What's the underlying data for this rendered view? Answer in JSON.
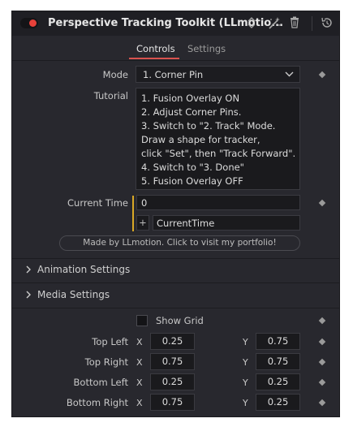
{
  "header": {
    "title": "Perspective Tracking Toolkit (LLmotio..."
  },
  "tabs": [
    {
      "label": "Controls"
    },
    {
      "label": "Settings"
    }
  ],
  "mode": {
    "label": "Mode",
    "value": "1. Corner Pin"
  },
  "tutorial": {
    "label": "Tutorial",
    "lines": [
      "1. Fusion Overlay ON",
      "2. Adjust Corner Pins.",
      "3. Switch to \"2. Track\" Mode.",
      "Draw a shape for tracker,",
      "click \"Set\", then \"Track Forward\".",
      "4. Switch to \"3. Done\"",
      "5. Fusion Overlay OFF"
    ]
  },
  "current_time": {
    "label": "Current Time",
    "value": "0",
    "expression": "CurrentTime",
    "plus": "+"
  },
  "portfolio_button": "Made by LLmotion. Click to visit my portfolio!",
  "sections": [
    {
      "label": "Animation Settings"
    },
    {
      "label": "Media Settings"
    }
  ],
  "show_grid": {
    "label": "Show Grid",
    "checked": false
  },
  "corners": [
    {
      "label": "Top Left",
      "x": "0.25",
      "y": "0.75"
    },
    {
      "label": "Top Right",
      "x": "0.75",
      "y": "0.75"
    },
    {
      "label": "Bottom Left",
      "x": "0.25",
      "y": "0.25"
    },
    {
      "label": "Bottom Right",
      "x": "0.75",
      "y": "0.25"
    }
  ],
  "axis_x": "X",
  "axis_y": "Y",
  "colors": {
    "accent": "#d9534f",
    "panel": "#28282e",
    "record_dot": "#e8413a"
  }
}
